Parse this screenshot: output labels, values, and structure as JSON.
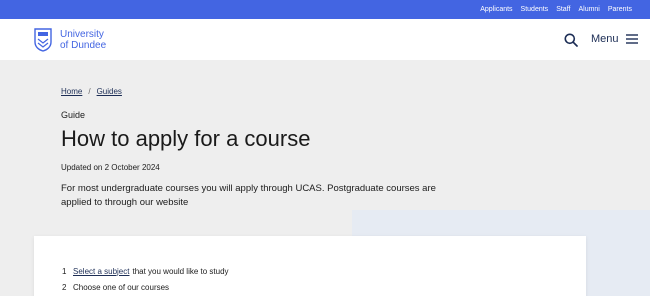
{
  "topbar": {
    "links": [
      "Applicants",
      "Students",
      "Staff",
      "Alumni",
      "Parents"
    ]
  },
  "header": {
    "logo_line1": "University",
    "logo_line2": "of Dundee",
    "menu_label": "Menu"
  },
  "breadcrumb": {
    "items": [
      "Home",
      "Guides"
    ],
    "separator": "/"
  },
  "page": {
    "eyebrow": "Guide",
    "title": "How to apply for a course",
    "updated": "Updated on 2 October 2024",
    "intro": "For most undergraduate courses you will apply through UCAS. Postgraduate courses are applied to through our website"
  },
  "steps": [
    {
      "num": "1",
      "link": "Select a subject",
      "text": "that you would like to study"
    },
    {
      "num": "2",
      "link": "",
      "text": "Choose one of our courses"
    }
  ],
  "colors": {
    "brand_blue": "#4365e2",
    "navy": "#1c2d55",
    "background": "#eeeeee"
  }
}
